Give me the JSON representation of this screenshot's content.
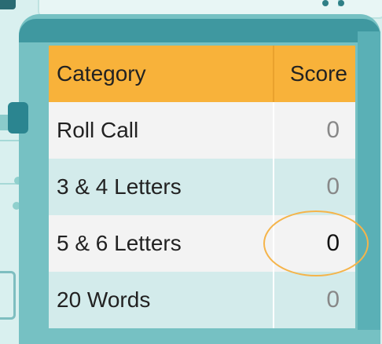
{
  "table": {
    "headers": {
      "category": "Category",
      "score": "Score"
    },
    "rows": [
      {
        "category": "Roll Call",
        "score": "0"
      },
      {
        "category": "3 & 4 Letters",
        "score": "0"
      },
      {
        "category": "5 & 6 Letters",
        "score": "0",
        "highlighted": true
      },
      {
        "category": "20 Words",
        "score": "0"
      }
    ]
  },
  "colors": {
    "header_bg": "#f8b23a",
    "frame": "#76c1c3",
    "highlight_ring": "#f5b44a",
    "row_light": "#f3f3f3",
    "row_teal": "#d3ebeb"
  }
}
